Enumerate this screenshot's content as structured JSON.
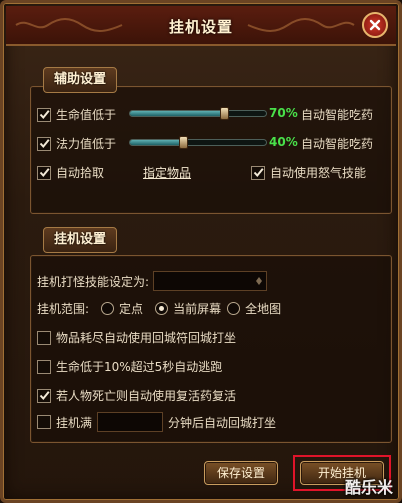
{
  "window": {
    "title": "挂机设置"
  },
  "assist": {
    "section_label": "辅助设置",
    "hp": {
      "label": "生命值低于",
      "percent_text": "70%",
      "value": 0.7,
      "action": "自动智能吃药",
      "checked": true
    },
    "mp": {
      "label": "法力值低于",
      "percent_text": "40%",
      "value": 0.4,
      "action": "自动智能吃药",
      "checked": true
    },
    "auto_pickup": {
      "label": "自动拾取",
      "checked": true
    },
    "specify_items_link": "指定物品",
    "auto_rage_skill": {
      "label": "自动使用怒气技能",
      "checked": true
    }
  },
  "hangup": {
    "section_label": "挂机设置",
    "skill_label": "挂机打怪技能设定为:",
    "range_label": "挂机范围:",
    "range_options": [
      {
        "label": "定点",
        "selected": false
      },
      {
        "label": "当前屏幕",
        "selected": true
      },
      {
        "label": "全地图",
        "selected": false
      }
    ],
    "options": [
      {
        "label": "物品耗尽自动使用回城符回城打坐",
        "checked": false
      },
      {
        "label": "生命低于10%超过5秒自动逃跑",
        "checked": false
      },
      {
        "label": "若人物死亡则自动使用复活药复活",
        "checked": true
      }
    ],
    "full_prefix": "挂机满",
    "full_suffix": "分钟后自动回城打坐",
    "full_checked": false
  },
  "buttons": {
    "save": "保存设置",
    "start": "开始挂机"
  },
  "watermark": "酷乐米",
  "colors": {
    "percent_green": "#49e04a",
    "highlight_red": "#e0142a",
    "accent_gold": "#a57a45"
  }
}
